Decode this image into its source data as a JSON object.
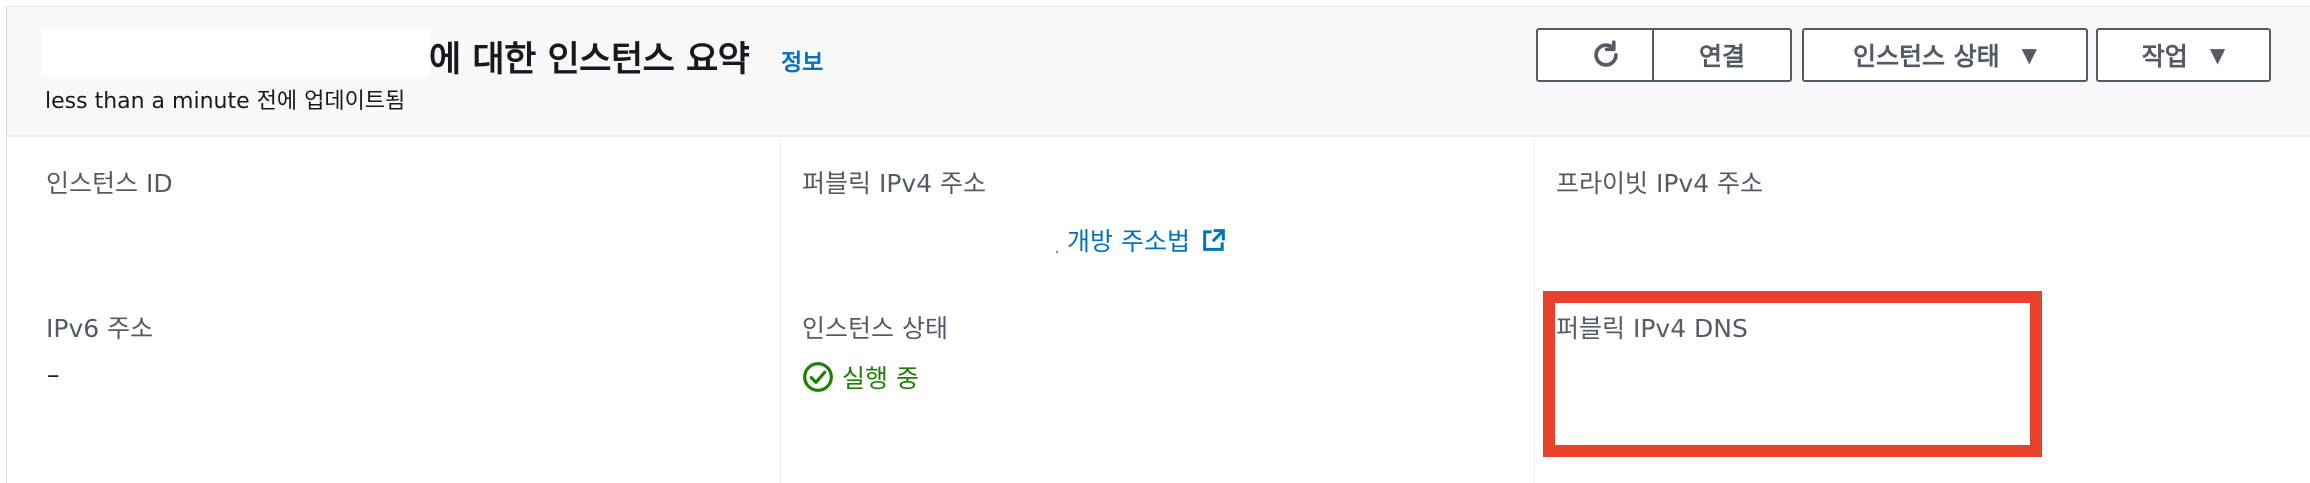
{
  "header": {
    "title_suffix": "에 대한 인스턴스 요약",
    "info_link": "정보",
    "updated": "less than a minute 전에 업데이트됨"
  },
  "toolbar": {
    "refresh_icon": "refresh-icon",
    "connect_label": "연결",
    "instance_state_label": "인스턴스 상태",
    "actions_label": "작업"
  },
  "details": {
    "instance_id": {
      "label": "인스턴스 ID"
    },
    "public_ipv4": {
      "label": "퍼블릭 IPv4 주소",
      "link": "개방 주소법",
      "link_icon": "external-link-icon"
    },
    "private_ipv4": {
      "label": "프라이빗 IPv4 주소"
    },
    "ipv6": {
      "label": "IPv6 주소",
      "value": "–"
    },
    "instance_state": {
      "label": "인스턴스 상태",
      "value": "실행 중",
      "icon": "check-circle-icon"
    },
    "public_dns": {
      "label": "퍼블릭 IPv4 DNS"
    }
  },
  "colors": {
    "link": "#0073bb",
    "running": "#1d8102",
    "highlight": "#e8412b"
  }
}
